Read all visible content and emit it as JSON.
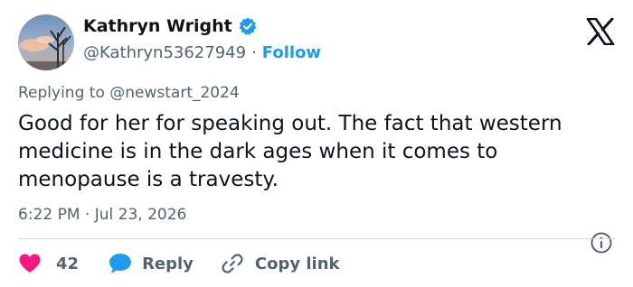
{
  "author": {
    "name": "Kathryn Wright",
    "handle": "@Kathryn53627949",
    "separator": "·",
    "follow_label": "Follow",
    "verified_color": "#1d9bf0"
  },
  "replying": {
    "prefix": "Replying to",
    "mention": "@newstart_2024"
  },
  "tweet": {
    "text": "Good for her for speaking out. The fact that western medicine is in the dark ages when it comes to menopause is a travesty.",
    "timestamp": "6:22 PM · Jul 23, 2026"
  },
  "actions": {
    "like_count": "42",
    "reply_label": "Reply",
    "copy_link_label": "Copy link",
    "like_color": "#f91880",
    "reply_color": "#1d9bf0"
  },
  "icons": [
    "avatar-photo",
    "verified-badge-icon",
    "x-logo-icon",
    "info-icon",
    "heart-icon",
    "reply-bubble-icon",
    "link-icon"
  ]
}
